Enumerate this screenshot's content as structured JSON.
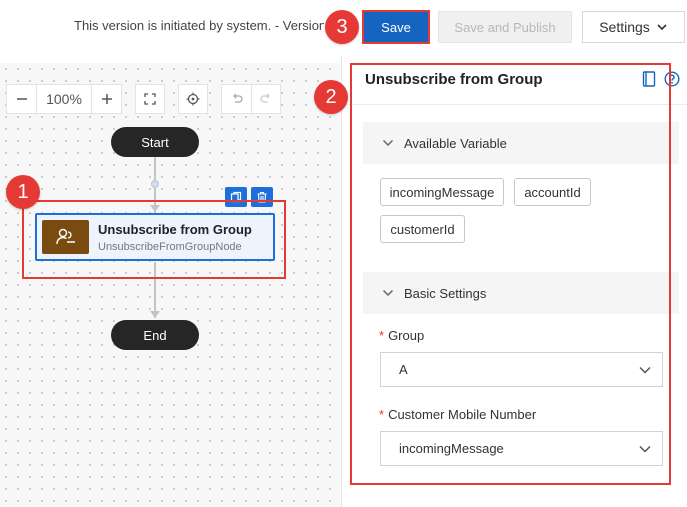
{
  "topbar": {
    "version_text": "This version is initiated by system. - Version",
    "save_label": "Save",
    "save_publish_label": "Save and Publish",
    "settings_label": "Settings"
  },
  "toolbar": {
    "zoom_level": "100%"
  },
  "canvas": {
    "start_label": "Start",
    "end_label": "End",
    "node": {
      "title": "Unsubscribe from Group",
      "subtitle": "UnsubscribeFromGroupNode"
    }
  },
  "panel": {
    "title": "Unsubscribe from Group",
    "available_variable": {
      "label": "Available Variable",
      "tags": [
        "incomingMessage",
        "accountId",
        "customerId"
      ]
    },
    "basic_settings": {
      "label": "Basic Settings",
      "group_label": "Group",
      "group_value": "A",
      "mobile_label": "Customer Mobile Number",
      "mobile_value": "incomingMessage"
    }
  },
  "annotations": {
    "badge_1": "1",
    "badge_2": "2",
    "badge_3": "3"
  },
  "colors": {
    "primary": "#1565c0",
    "node_border": "#1e6fd9",
    "node_icon_bg": "#7a4b10",
    "annotation": "#e53935"
  }
}
